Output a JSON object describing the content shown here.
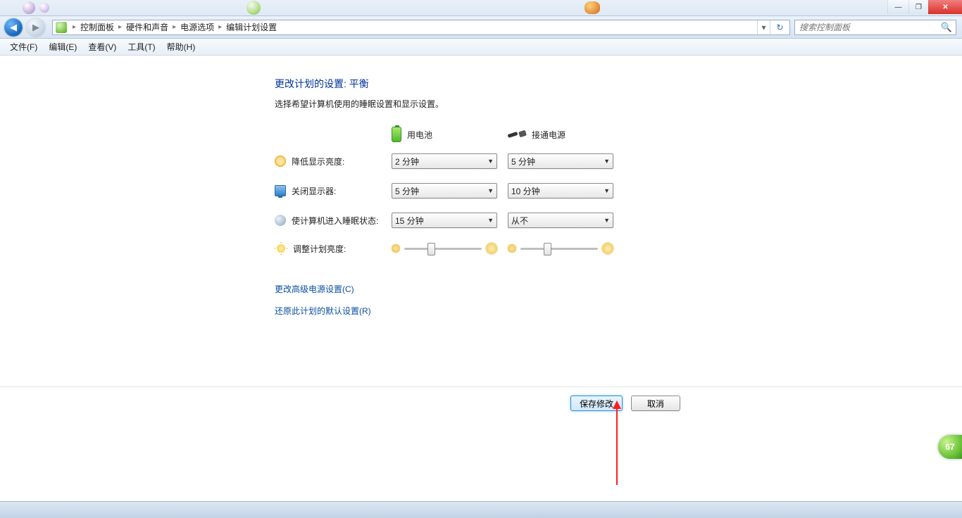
{
  "window": {
    "min_tip": "—",
    "max_tip": "❐",
    "close_tip": "✕"
  },
  "breadcrumb": {
    "items": [
      "控制面板",
      "硬件和声音",
      "电源选项",
      "编辑计划设置"
    ]
  },
  "search": {
    "placeholder": "搜索控制面板"
  },
  "menu": {
    "items": [
      "文件(F)",
      "编辑(E)",
      "查看(V)",
      "工具(T)",
      "帮助(H)"
    ]
  },
  "page": {
    "title": "更改计划的设置: 平衡",
    "subtitle": "选择希望计算机使用的睡眠设置和显示设置。",
    "col_battery": "用电池",
    "col_plugged": "接通电源",
    "rows": {
      "dim": {
        "label": "降低显示亮度:",
        "battery": "2 分钟",
        "plugged": "5 分钟"
      },
      "display": {
        "label": "关闭显示器:",
        "battery": "5 分钟",
        "plugged": "10 分钟"
      },
      "sleep": {
        "label": "使计算机进入睡眠状态:",
        "battery": "15 分钟",
        "plugged": "从不"
      },
      "bright": {
        "label": "调整计划亮度:"
      }
    },
    "slider": {
      "battery_pct": 30,
      "plugged_pct": 30
    },
    "link_advanced": "更改高级电源设置(C)",
    "link_restore": "还原此计划的默认设置(R)",
    "btn_save": "保存修改",
    "btn_cancel": "取消"
  },
  "badge": "67"
}
